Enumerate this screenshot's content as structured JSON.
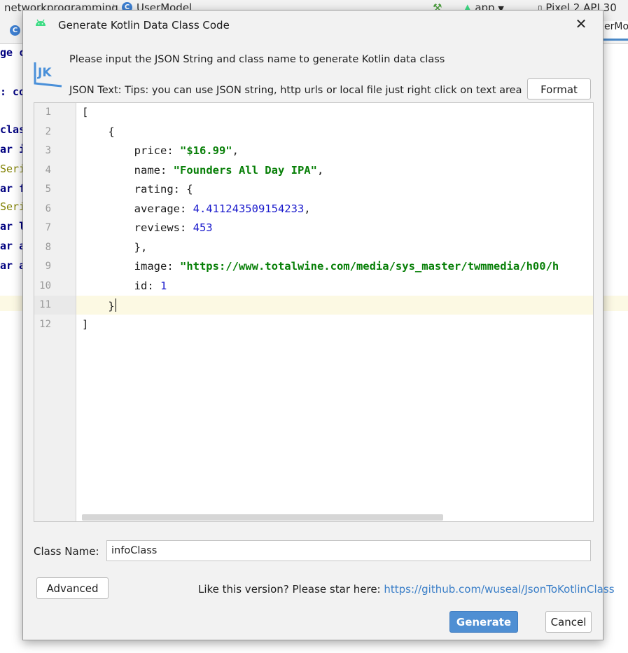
{
  "ide": {
    "breadcrumb_project": "networkprogramming",
    "breadcrumb_file": "UserModel",
    "run_config": "app",
    "device": "Pixel 2 API 30",
    "right_tab": "erMod",
    "code_fragments": [
      "ge c",
      ": co",
      "clas",
      "ar i",
      "Seri",
      "ar f",
      "Seri",
      "ar l",
      "ar a",
      "ar a"
    ]
  },
  "dialog": {
    "title": "Generate Kotlin Data Class Code",
    "logo_text": "JK",
    "intro_text": "Please input the JSON String and class name to generate Kotlin data class",
    "json_text_label": "JSON Text: Tips: you can use JSON string, http urls or local file just right click on text area",
    "format_label": "Format",
    "editor": {
      "line_numbers": [
        "1",
        "2",
        "3",
        "4",
        "5",
        "6",
        "7",
        "8",
        "9",
        "10",
        "11",
        "12"
      ],
      "lines": {
        "l1": "[",
        "l2": "    {",
        "l3_key": "        price: ",
        "l3_val": "\"$16.99\"",
        "l3_end": ",",
        "l4_key": "        name: ",
        "l4_val": "\"Founders All Day IPA\"",
        "l4_end": ",",
        "l5": "        rating: {",
        "l6_key": "        average: ",
        "l6_val": "4.411243509154233",
        "l6_end": ",",
        "l7_key": "        reviews: ",
        "l7_val": "453",
        "l8": "        },",
        "l9_key": "        image: ",
        "l9_val": "\"https://www.totalwine.com/media/sys_master/twmmedia/h00/h",
        "l10_key": "        id: ",
        "l10_val": "1",
        "l11": "    }",
        "l12": "]"
      }
    },
    "class_name_label": "Class Name:",
    "class_name_value": "infoClass",
    "advanced_label": "Advanced",
    "star_prompt": "Like this version? Please star here: ",
    "star_link": "https://github.com/wuseal/JsonToKotlinClass",
    "generate_label": "Generate",
    "cancel_label": "Cancel"
  },
  "colors": {
    "accent": "#4f8fd3",
    "string": "#077f07",
    "number": "#1a1acc",
    "link": "#3b7fc8"
  }
}
